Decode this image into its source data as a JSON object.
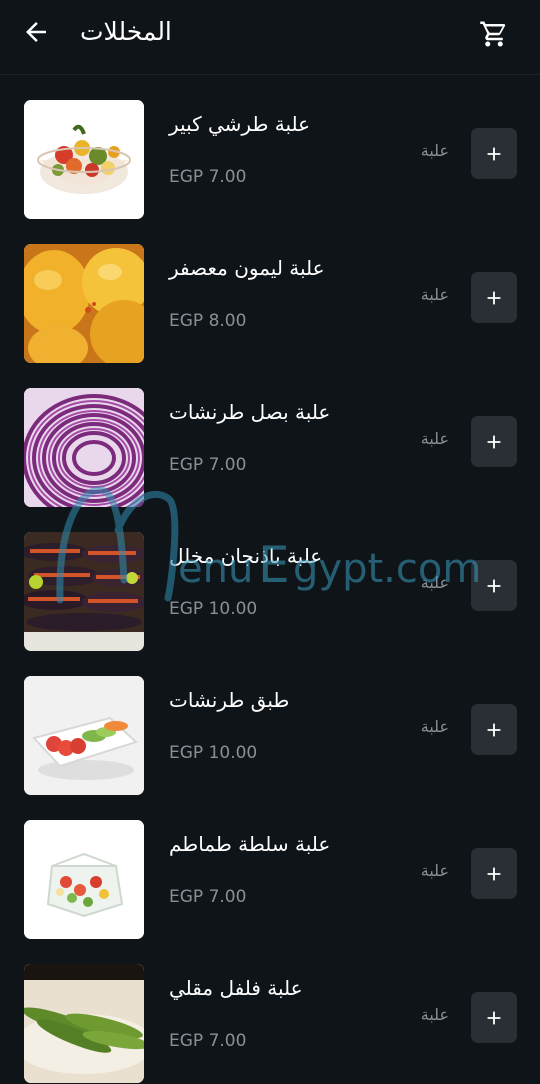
{
  "header": {
    "title": "المخللات",
    "back_icon": "arrow-left-icon",
    "cart_icon": "cart-icon"
  },
  "items": [
    {
      "name": "علبة طرشي كبير",
      "unit": "علبة",
      "price": "EGP 7.00",
      "image": "mixed-pickles-bowl"
    },
    {
      "name": "علبة ليمون معصفر",
      "unit": "علبة",
      "price": "EGP 8.00",
      "image": "yellow-lemons"
    },
    {
      "name": "علبة بصل طرنشات",
      "unit": "علبة",
      "price": "EGP 7.00",
      "image": "red-onion-slices"
    },
    {
      "name": "علبة باذنجان مخلل",
      "unit": "علبة",
      "price": "EGP 10.00",
      "image": "pickled-eggplant-tray"
    },
    {
      "name": "طبق طرنشات",
      "unit": "علبة",
      "price": "EGP 10.00",
      "image": "sliced-vegetables-plate"
    },
    {
      "name": "علبة سلطة طماطم",
      "unit": "علبة",
      "price": "EGP 7.00",
      "image": "tomato-salad-box"
    },
    {
      "name": "علبة فلفل مقلي",
      "unit": "علبة",
      "price": "EGP 7.00",
      "image": "fried-green-peppers"
    }
  ],
  "watermark": "Menu Egypt.com",
  "colors": {
    "background": "#0f1419",
    "button_bg": "#2a2f36",
    "muted_text": "#8a8f96"
  }
}
